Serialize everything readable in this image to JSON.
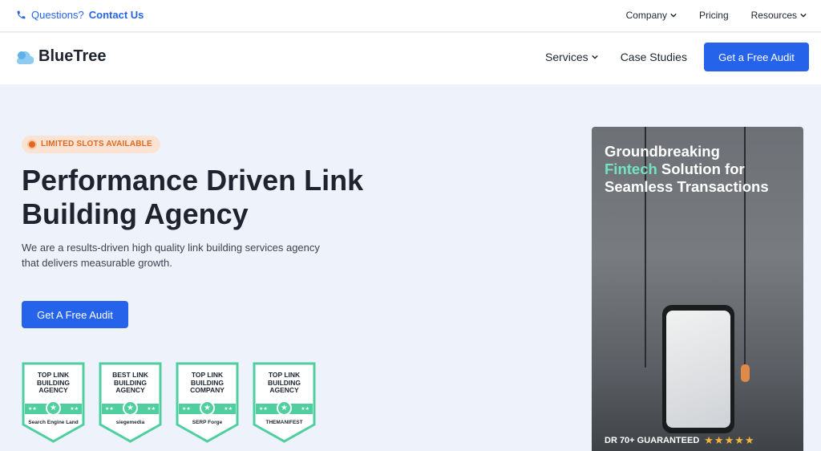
{
  "topbar": {
    "contact_prefix": "Questions?",
    "contact_link": "Contact Us",
    "links": [
      "Company",
      "Pricing",
      "Resources"
    ]
  },
  "nav": {
    "logo": "BlueTree",
    "menu": [
      "Services",
      "Case Studies"
    ],
    "cta": "Get a Free Audit"
  },
  "hero": {
    "badge": "LIMITED SLOTS AVAILABLE",
    "title": "Performance Driven Link Building Agency",
    "lead": "We are a results-driven high quality link building services agency that delivers measurable growth.",
    "cta": "Get A Free Audit"
  },
  "awards": [
    {
      "title": "TOP LINK BUILDING AGENCY",
      "brand": "Search Engine Land"
    },
    {
      "title": "BEST LINK BUILDING AGENCY",
      "brand": "siegemedia"
    },
    {
      "title": "TOP LINK BUILDING COMPANY",
      "brand": "SERP Forge"
    },
    {
      "title": "TOP LINK BUILDING AGENCY",
      "brand": "THEMANIFEST"
    }
  ],
  "card": {
    "headline_1": "Groundbreaking",
    "headline_highlight": "Fintech",
    "headline_2": "Solution for Seamless Transactions",
    "footer": "DR 70+ GUARANTEED",
    "stars": "★★★★★"
  },
  "colors": {
    "accent": "#2563eb",
    "badge_text": "#e0691f",
    "award_green": "#4fcf9f",
    "highlight": "#73e3c0"
  }
}
